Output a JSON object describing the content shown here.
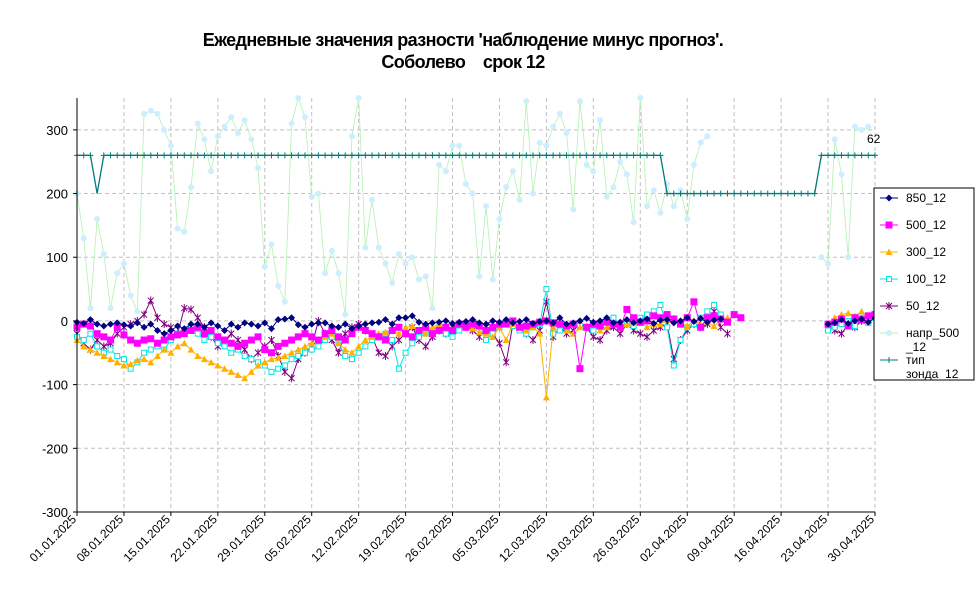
{
  "chart_data": {
    "type": "line",
    "title_line1": "Ежедневные значения разности 'наблюдение минус прогноз'.",
    "title_line2": "Соболево    срок 12",
    "ylim": [
      -300,
      350
    ],
    "yticks": [
      -300,
      -200,
      -100,
      0,
      100,
      200,
      300
    ],
    "x_start": "01.01.2025",
    "x_end": "30.04.2025",
    "xticks": [
      "01.01.2025",
      "08.01.2025",
      "15.01.2025",
      "22.01.2025",
      "29.01.2025",
      "05.02.2025",
      "12.02.2025",
      "19.02.2025",
      "26.02.2025",
      "05.03.2025",
      "12.03.2025",
      "19.03.2025",
      "26.03.2025",
      "02.04.2025",
      "09.04.2025",
      "16.04.2025",
      "23.04.2025",
      "30.04.2025"
    ],
    "grid": true,
    "legend_position": "right",
    "annotation": "62",
    "series": [
      {
        "name": "850_12",
        "color": "#000080",
        "marker": "diamond",
        "segments": [
          {
            "start": 1,
            "values": [
              -2,
              -4,
              2,
              -5,
              -8,
              -5,
              -3,
              -6,
              -8,
              -3,
              -10,
              -5,
              -15,
              -20,
              -15,
              -8,
              -12,
              -5,
              -5,
              -10,
              -3,
              -8,
              -15,
              -5,
              -10,
              -3,
              -5,
              -8,
              -3,
              -12,
              2,
              3,
              5,
              -6,
              -10,
              -5,
              -3,
              -3,
              -8,
              -10,
              -5,
              -12,
              -8,
              -5,
              -3,
              -2,
              2,
              -5,
              5,
              5,
              8,
              -2,
              -5,
              -3,
              -2,
              0,
              -4,
              -2,
              -1,
              2,
              -3,
              -5,
              0,
              -2,
              2,
              -3,
              -1,
              2,
              -4,
              -1,
              0,
              -3,
              5,
              -5,
              -3,
              0,
              4,
              -2,
              0,
              5,
              -3,
              -2,
              2,
              -3,
              0,
              3,
              -4,
              1,
              2,
              -3,
              0,
              5,
              -1,
              4,
              -2,
              1,
              3
            ]
          },
          {
            "start": 113,
            "values": [
              -5,
              -3,
              2,
              -4,
              0,
              3,
              -2,
              5
            ]
          }
        ]
      },
      {
        "name": "500_12",
        "color": "#FF00FF",
        "marker": "square",
        "segments": [
          {
            "start": 1,
            "values": [
              -10,
              -5,
              -8,
              -20,
              -25,
              -30,
              -10,
              -22,
              -30,
              -35,
              -30,
              -28,
              -35,
              -30,
              -25,
              -22,
              -20,
              -15,
              -10,
              -20,
              -15,
              -25,
              -30,
              -35,
              -40,
              -35,
              -30,
              -25,
              -45,
              -50,
              -40,
              -35,
              -30,
              -25,
              -20,
              -25,
              -30,
              -20,
              -15,
              -25,
              -30,
              -20,
              -10,
              -15,
              -20,
              -25,
              -30,
              -15,
              -10,
              -20,
              -25,
              -15,
              -10,
              -20,
              -15,
              -10,
              -15,
              -5,
              -10,
              -5,
              -8,
              -15,
              -10,
              -5,
              -5,
              0,
              -10,
              -8,
              -5,
              -2,
              0,
              -3,
              -5,
              -8,
              -5,
              -75,
              -10,
              -5,
              -8,
              -2,
              -5,
              -10,
              18,
              5,
              -2,
              0,
              8,
              5,
              10,
              3,
              -5,
              5,
              30,
              -10,
              5,
              8,
              3,
              -2,
              10,
              5
            ]
          },
          {
            "start": 113,
            "values": [
              -5,
              -2,
              3,
              -8,
              5,
              2,
              8,
              10
            ]
          }
        ]
      },
      {
        "name": "300_12",
        "color": "#FFB000",
        "marker": "triangle",
        "segments": [
          {
            "start": 1,
            "values": [
              -30,
              -40,
              -45,
              -50,
              -55,
              -60,
              -65,
              -70,
              -68,
              -62,
              -60,
              -65,
              -55,
              -45,
              -50,
              -40,
              -35,
              -45,
              -55,
              -60,
              -65,
              -70,
              -75,
              -80,
              -85,
              -90,
              -80,
              -70,
              -65,
              -60,
              -58,
              -55,
              -50,
              -45,
              -40,
              -35,
              -30,
              -25,
              -20,
              -35,
              -45,
              -50,
              -40,
              -30,
              -25,
              -20,
              -18,
              -15,
              -20,
              -10,
              -8,
              -15,
              -20,
              -10,
              -5,
              -8,
              -2,
              -5,
              -10,
              -12,
              -18,
              -20,
              -25,
              -10,
              -30,
              -5,
              -8,
              -15,
              -10,
              -20,
              -120,
              -10,
              -5,
              -15,
              -20,
              -10,
              -8,
              -5,
              -15,
              -10,
              -5,
              -8,
              -5,
              -2,
              -3,
              -10,
              -5,
              -5,
              2,
              5,
              -3,
              -8,
              0,
              -5,
              -2,
              -8,
              2,
              5
            ]
          },
          {
            "start": 113,
            "values": [
              -5,
              5,
              10,
              12,
              8,
              15,
              5,
              10
            ]
          }
        ]
      },
      {
        "name": "100_12",
        "color": "#00E5E5",
        "marker": "square-open",
        "segments": [
          {
            "start": 1,
            "values": [
              -25,
              -30,
              -20,
              -40,
              -50,
              -45,
              -55,
              -60,
              -75,
              -65,
              -50,
              -45,
              -40,
              -45,
              -30,
              -20,
              -15,
              -10,
              -20,
              -30,
              -25,
              -35,
              -40,
              -50,
              -45,
              -55,
              -60,
              -65,
              -70,
              -80,
              -75,
              -70,
              -60,
              -55,
              -50,
              -45,
              -40,
              -30,
              -25,
              -35,
              -55,
              -60,
              -50,
              -40,
              -30,
              -25,
              -20,
              -30,
              -75,
              -50,
              -35,
              -25,
              -20,
              -15,
              -10,
              -20,
              -25,
              -15,
              -10,
              -5,
              -8,
              -30,
              -20,
              -10,
              -5,
              -8,
              -15,
              -20,
              -10,
              -5,
              50,
              -20,
              -15,
              -10,
              -5,
              -8,
              -10,
              -15,
              -5,
              0,
              5,
              -10,
              -5,
              -8,
              5,
              10,
              15,
              25,
              -10,
              -70,
              -30,
              -10,
              -5,
              5,
              15,
              25,
              10
            ]
          },
          {
            "start": 113,
            "values": [
              -15,
              -10,
              -5,
              0,
              -8,
              5,
              -3,
              5
            ]
          }
        ]
      },
      {
        "name": "50_12",
        "color": "#800080",
        "marker": "star",
        "segments": [
          {
            "start": 1,
            "values": [
              -20,
              -35,
              -45,
              -30,
              -40,
              -35,
              -20,
              -10,
              -5,
              0,
              10,
              32,
              5,
              -5,
              -10,
              -20,
              20,
              18,
              5,
              -10,
              -25,
              -40,
              -35,
              -20,
              -30,
              -45,
              -60,
              -50,
              -40,
              -30,
              -55,
              -80,
              -90,
              -60,
              -50,
              -40,
              0,
              -20,
              -30,
              -50,
              -20,
              -10,
              -5,
              -15,
              -25,
              -50,
              -55,
              -40,
              -30,
              -20,
              -10,
              -30,
              -40,
              -25,
              -15,
              -20,
              -10,
              -5,
              -8,
              -15,
              -25,
              -10,
              -20,
              -35,
              -65,
              -5,
              -10,
              -20,
              -30,
              -15,
              30,
              -25,
              -10,
              -20,
              -15,
              -5,
              -10,
              -25,
              -30,
              -15,
              -10,
              -20,
              -5,
              -15,
              -20,
              -25,
              -15,
              -10,
              -5,
              -60,
              -30,
              -15,
              -5,
              -10,
              -5,
              15,
              -10,
              -20
            ]
          },
          {
            "start": 113,
            "values": [
              -10,
              -15,
              -20,
              -5,
              -10,
              0,
              5,
              10
            ]
          }
        ]
      },
      {
        "name": "напр_500_12",
        "color": "#CCEEFF",
        "line_color": "#B2F0B2",
        "marker": "circle",
        "segments": [
          {
            "start": 1,
            "values": [
              200,
              130,
              20,
              160,
              105,
              20,
              75,
              90,
              40,
              15,
              325,
              330,
              325,
              300,
              275,
              145,
              140,
              210,
              310,
              285,
              235,
              290,
              305,
              320,
              295,
              315,
              285,
              240,
              85,
              120,
              55,
              30,
              310,
              350,
              320,
              195,
              200,
              75,
              110,
              75,
              10,
              290,
              350,
              115,
              190,
              115,
              90,
              60,
              105,
              90,
              100,
              65,
              70,
              20,
              245,
              235,
              275,
              275,
              215,
              200,
              70,
              180,
              65,
              160,
              210,
              235,
              190,
              345,
              200,
              280,
              275,
              305,
              325,
              295,
              175,
              345,
              245,
              235,
              315,
              195,
              210,
              250,
              230,
              155,
              350,
              180,
              205,
              170,
              215,
              180,
              205,
              160,
              245,
              280,
              290
            ]
          },
          {
            "start": 112,
            "values": [
              100,
              90,
              285,
              230,
              100,
              305,
              300,
              305
            ]
          }
        ]
      },
      {
        "name": "тип зонда_12",
        "color": "#007B7B",
        "marker": "plus",
        "segments": [
          {
            "start": 1,
            "points": [
              [
                1,
                260
              ],
              [
                3,
                260
              ],
              [
                4,
                200
              ],
              [
                5,
                260
              ],
              [
                88,
                260
              ],
              [
                89,
                200
              ],
              [
                111,
                200
              ],
              [
                112,
                260
              ],
              [
                120,
                260
              ]
            ]
          }
        ]
      }
    ]
  }
}
